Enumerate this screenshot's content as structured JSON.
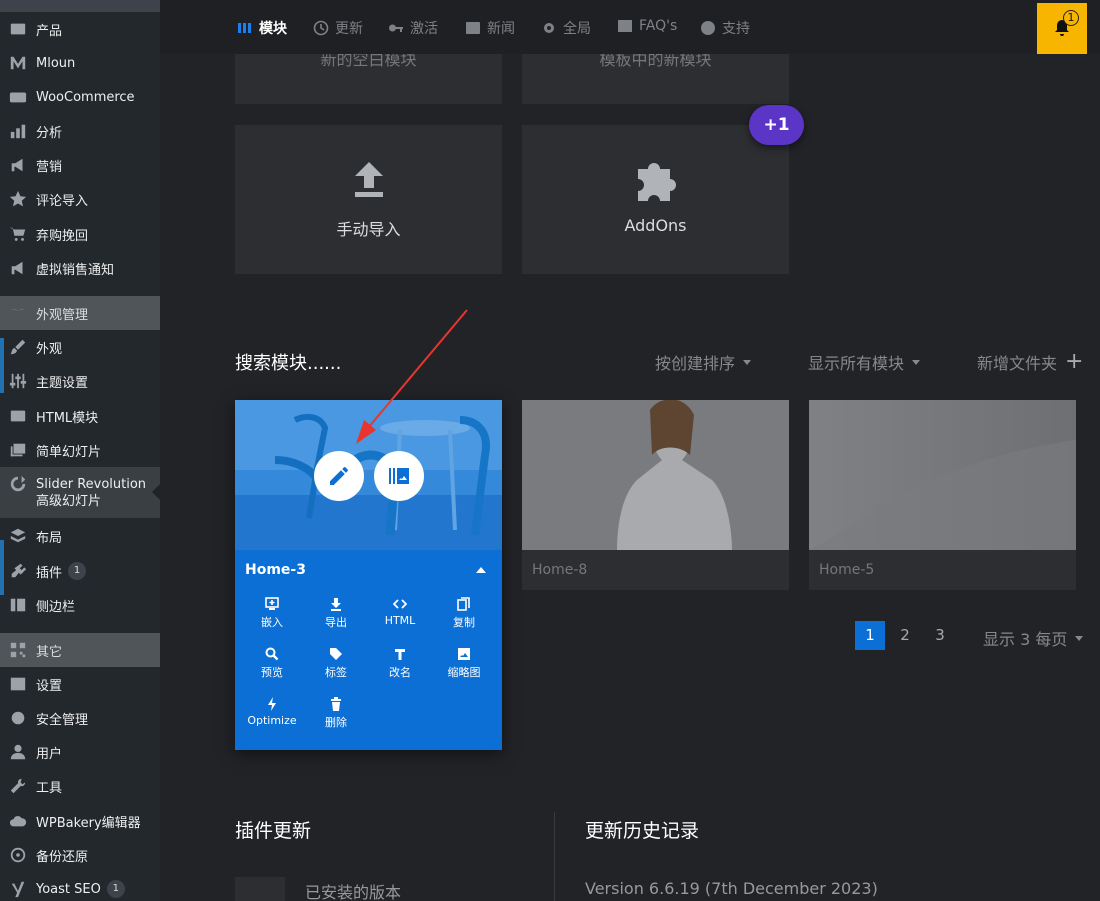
{
  "sidebar": {
    "items": [
      {
        "label": "产品",
        "icon": "products-icon"
      },
      {
        "label": "Mloun",
        "icon": "mloun-icon"
      },
      {
        "label": "WooCommerce",
        "icon": "woo-icon"
      },
      {
        "label": "分析",
        "icon": "analytics-icon"
      },
      {
        "label": "营销",
        "icon": "marketing-icon"
      },
      {
        "label": "评论导入",
        "icon": "star-icon"
      },
      {
        "label": "弃购挽回",
        "icon": "cart-icon"
      },
      {
        "label": "虚拟销售通知",
        "icon": "megaphone-icon"
      },
      {
        "label": "外观管理",
        "icon": "palm-icon"
      },
      {
        "label": "外观",
        "icon": "brush-icon"
      },
      {
        "label": "主题设置",
        "icon": "sliders-icon"
      },
      {
        "label": "HTML模块",
        "icon": "html-icon"
      },
      {
        "label": "简单幻灯片",
        "icon": "gallery-icon"
      },
      {
        "label": "Slider Revolution",
        "label2": "高级幻灯片",
        "icon": "revolution-icon"
      },
      {
        "label": "布局",
        "icon": "layers-icon"
      },
      {
        "label": "插件",
        "icon": "plugin-icon",
        "badge": "1"
      },
      {
        "label": "侧边栏",
        "icon": "sidebar-icon"
      },
      {
        "label": "其它",
        "icon": "qr-icon"
      },
      {
        "label": "设置",
        "icon": "settings-icon"
      },
      {
        "label": "安全管理",
        "icon": "lock-gear-icon"
      },
      {
        "label": "用户",
        "icon": "user-icon"
      },
      {
        "label": "工具",
        "icon": "wrench-icon"
      },
      {
        "label": "WPBakery编辑器",
        "icon": "cloud-icon"
      },
      {
        "label": "备份还原",
        "icon": "backup-icon"
      },
      {
        "label": "Yoast SEO",
        "icon": "yoast-icon",
        "badge": "1"
      }
    ]
  },
  "topnav": {
    "items": [
      "模块",
      "更新",
      "激活",
      "新闻",
      "全局",
      "FAQ's",
      "支持"
    ],
    "notifications": "1"
  },
  "tiles": {
    "cut_left": "新的空白模块",
    "cut_right": "模板中的新模块",
    "manual_import": "手动导入",
    "addons": "AddOns",
    "addons_badge": "+1"
  },
  "search": {
    "title": "搜索模块......",
    "sort_by": "按创建排序",
    "filter": "显示所有模块",
    "new_folder": "新增文件夹"
  },
  "modules": {
    "home3": {
      "name": "Home-3",
      "actions": [
        "嵌入",
        "导出",
        "HTML",
        "复制",
        "预览",
        "标签",
        "改名",
        "缩略图",
        "Optimize",
        "删除"
      ]
    },
    "home8": {
      "name": "Home-8"
    },
    "home5": {
      "name": "Home-5"
    }
  },
  "pagination": {
    "pages": [
      "1",
      "2",
      "3"
    ],
    "current": "1",
    "per_page": "显示 3 每页"
  },
  "bottom": {
    "plugin_updates": "插件更新",
    "history": "更新历史记录",
    "installed": "已安装的版本",
    "version": "Version 6.6.19 (7th December 2023)"
  },
  "colors": {
    "accent": "#0b6fd6",
    "badge_purple": "#5b35c6",
    "bell_yellow": "#f7b500"
  }
}
